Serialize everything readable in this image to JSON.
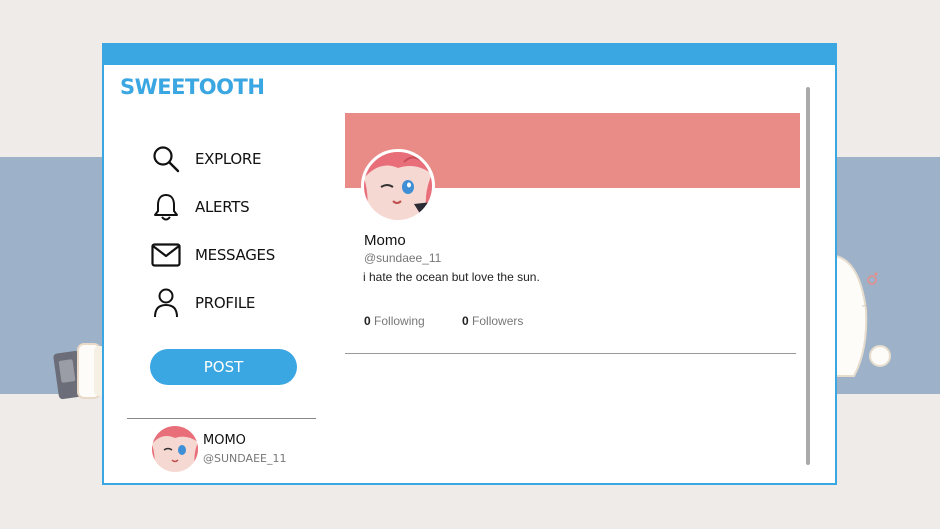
{
  "app": {
    "brand": "SWEETOOTH",
    "accent_color": "#3aa6e2",
    "banner_color": "#e98c87"
  },
  "nav": {
    "items": [
      {
        "label": "EXPLORE",
        "icon": "search-icon"
      },
      {
        "label": "ALERTS",
        "icon": "bell-icon"
      },
      {
        "label": "MESSAGES",
        "icon": "mail-icon"
      },
      {
        "label": "PROFILE",
        "icon": "user-icon"
      }
    ],
    "post_label": "POST"
  },
  "current_user": {
    "name": "MOMO",
    "handle": "@SUNDAEE_11"
  },
  "profile": {
    "name": "Momo",
    "handle": "@sundaee_11",
    "bio": "i hate the ocean but love the sun.",
    "following_count": "0",
    "following_label": "Following",
    "followers_count": "0",
    "followers_label": "Followers"
  }
}
